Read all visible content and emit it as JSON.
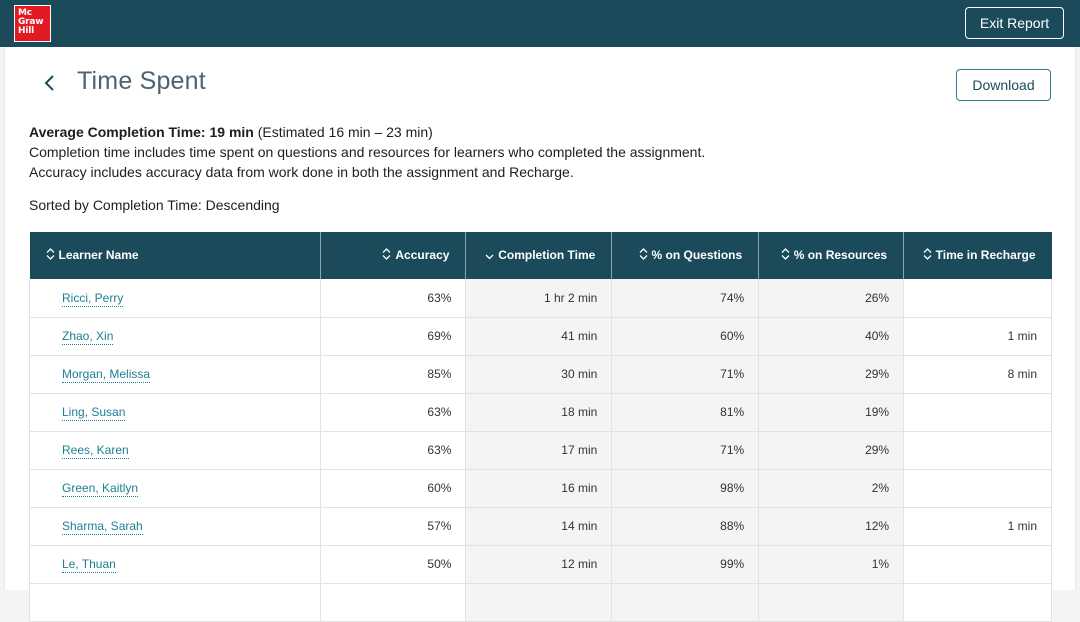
{
  "header": {
    "logo_lines": [
      "Mc",
      "Graw",
      "Hill"
    ],
    "exit_label": "Exit Report"
  },
  "page": {
    "title": "Time Spent",
    "download_label": "Download",
    "avg_label": "Average Completion Time: 19 min",
    "avg_estimate": " (Estimated 16 min – 23 min)",
    "note_1": "Completion time includes time spent on questions and resources for learners who completed the assignment.",
    "note_2": "Accuracy includes accuracy data from work done in both the assignment and Recharge.",
    "sorted_label": "Sorted by Completion Time: Descending"
  },
  "table": {
    "columns": [
      {
        "label": "Learner Name",
        "sort": "unsorted"
      },
      {
        "label": "Accuracy",
        "sort": "unsorted"
      },
      {
        "label": "Completion Time",
        "sort": "descending"
      },
      {
        "label": "% on Questions",
        "sort": "unsorted"
      },
      {
        "label": "% on Resources",
        "sort": "unsorted"
      },
      {
        "label": "Time in Recharge",
        "sort": "unsorted"
      }
    ],
    "rows": [
      {
        "name": "Ricci, Perry",
        "accuracy": "63%",
        "completion": "1 hr 2 min",
        "questions": "74%",
        "resources": "26%",
        "recharge": ""
      },
      {
        "name": "Zhao, Xin",
        "accuracy": "69%",
        "completion": "41 min",
        "questions": "60%",
        "resources": "40%",
        "recharge": "1 min"
      },
      {
        "name": "Morgan, Melissa",
        "accuracy": "85%",
        "completion": "30 min",
        "questions": "71%",
        "resources": "29%",
        "recharge": "8 min"
      },
      {
        "name": "Ling, Susan",
        "accuracy": "63%",
        "completion": "18 min",
        "questions": "81%",
        "resources": "19%",
        "recharge": ""
      },
      {
        "name": "Rees, Karen",
        "accuracy": "63%",
        "completion": "17 min",
        "questions": "71%",
        "resources": "29%",
        "recharge": ""
      },
      {
        "name": "Green, Kaitlyn",
        "accuracy": "60%",
        "completion": "16 min",
        "questions": "98%",
        "resources": "2%",
        "recharge": ""
      },
      {
        "name": "Sharma, Sarah",
        "accuracy": "57%",
        "completion": "14 min",
        "questions": "88%",
        "resources": "12%",
        "recharge": "1 min"
      },
      {
        "name": "Le, Thuan",
        "accuracy": "50%",
        "completion": "12 min",
        "questions": "99%",
        "resources": "1%",
        "recharge": ""
      },
      {
        "name": "",
        "accuracy": "",
        "completion": "",
        "questions": "",
        "resources": "",
        "recharge": ""
      }
    ]
  },
  "colors": {
    "header_bg": "#1b4b5a",
    "logo_red": "#e21a23",
    "link": "#1d7f93"
  }
}
